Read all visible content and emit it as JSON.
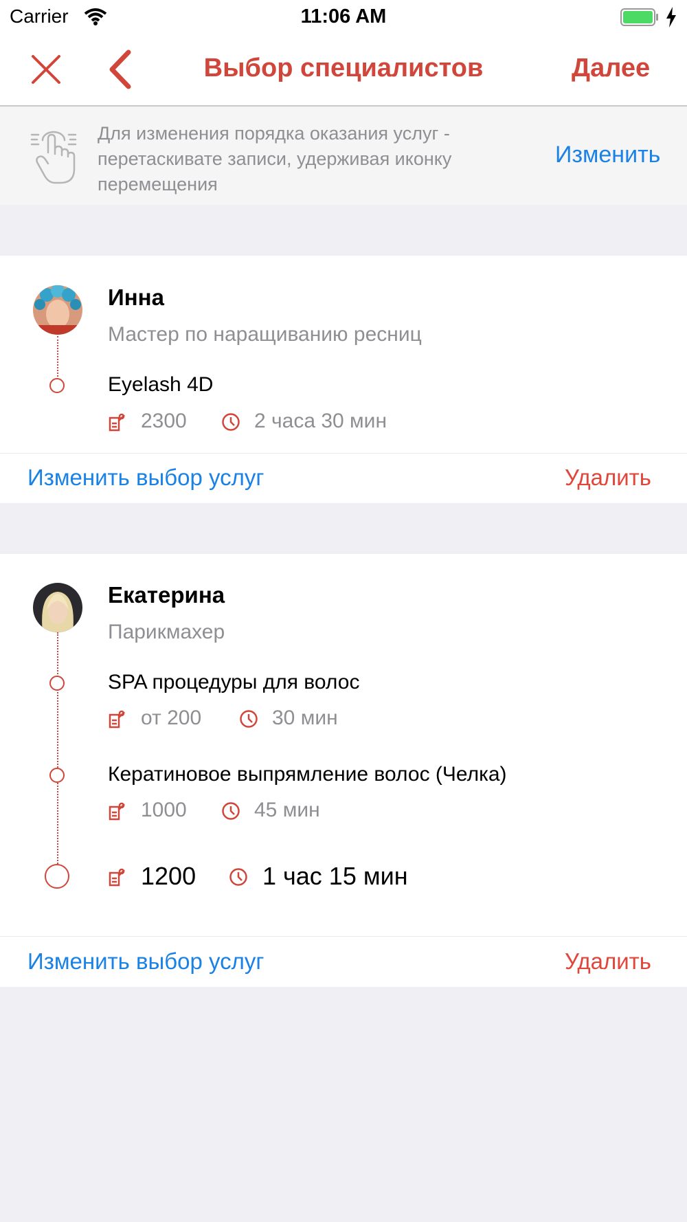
{
  "status_bar": {
    "carrier": "Carrier",
    "time": "11:06 AM"
  },
  "nav": {
    "title": "Выбор специалистов",
    "next_label": "Далее"
  },
  "hint": {
    "text": "Для изменения порядка оказания услуг - перетаскивате записи, удерживая иконку перемещения",
    "action_label": "Изменить"
  },
  "specialists": [
    {
      "name": "Инна",
      "role": "Мастер по наращиванию ресниц",
      "services": [
        {
          "title": "Eyelash 4D",
          "price": "2300",
          "duration": "2 часа 30 мин"
        }
      ],
      "change_label": "Изменить выбор услуг",
      "delete_label": "Удалить"
    },
    {
      "name": "Екатерина",
      "role": "Парикмахер",
      "services": [
        {
          "title": "SPA процедуры для волос",
          "price": "от 200",
          "duration": "30 мин"
        },
        {
          "title": "Кератиновое выпрямление волос (Челка)",
          "price": "1000",
          "duration": "45 мин"
        }
      ],
      "total": {
        "price": "1200",
        "duration": "1 час 15 мин"
      },
      "change_label": "Изменить выбор услуг",
      "delete_label": "Удалить"
    }
  ],
  "colors": {
    "accent_red": "#d0463a",
    "link_blue": "#1a82e6",
    "muted": "#8e8e93"
  }
}
